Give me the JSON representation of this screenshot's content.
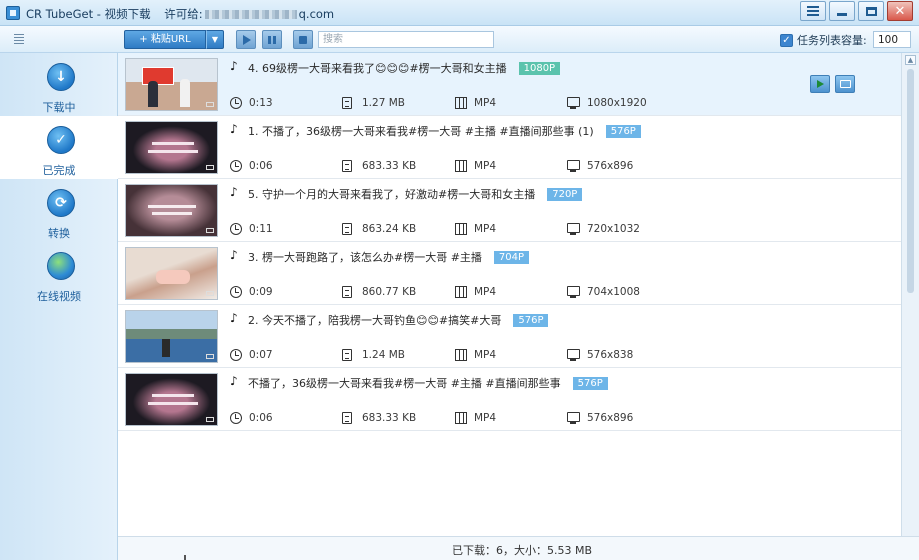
{
  "window": {
    "title_prefix": "CR TubeGet - 视频下载",
    "license_label": "许可给:",
    "license_suffix": "q.com"
  },
  "toolbar": {
    "paste_label": "+ 粘贴URL",
    "search_placeholder": "搜索",
    "capacity_label": "任务列表容量:",
    "capacity_value": "100",
    "capacity_checked": true
  },
  "sidebar": {
    "items": [
      {
        "label": "下载中",
        "icon": "download-icon"
      },
      {
        "label": "已完成",
        "icon": "check-icon"
      },
      {
        "label": "转换",
        "icon": "convert-icon"
      },
      {
        "label": "在线视频",
        "icon": "globe-icon"
      }
    ],
    "active_index": 1
  },
  "videos": [
    {
      "title": "4. 69级楞一大哥来看我了😊😊😊#楞一大哥和女主播",
      "resolution_badge": "1080P",
      "duration": "0:13",
      "size": "1.27 MB",
      "format": "MP4",
      "dimensions": "1080x1920"
    },
    {
      "title": "1. 不播了，36级楞一大哥来看我#楞一大哥 #主播 #直播间那些事 (1)",
      "resolution_badge": "576P",
      "duration": "0:06",
      "size": "683.33 KB",
      "format": "MP4",
      "dimensions": "576x896"
    },
    {
      "title": "5. 守护一个月的大哥来看我了，好激动#楞一大哥和女主播",
      "resolution_badge": "720P",
      "duration": "0:11",
      "size": "863.24 KB",
      "format": "MP4",
      "dimensions": "720x1032"
    },
    {
      "title": "3. 楞一大哥跑路了，该怎么办#楞一大哥 #主播",
      "resolution_badge": "704P",
      "duration": "0:09",
      "size": "860.77 KB",
      "format": "MP4",
      "dimensions": "704x1008"
    },
    {
      "title": "2. 今天不播了，陪我楞一大哥钓鱼😊😊#搞笑#大哥",
      "resolution_badge": "576P",
      "duration": "0:07",
      "size": "1.24 MB",
      "format": "MP4",
      "dimensions": "576x838"
    },
    {
      "title": "不播了，36级楞一大哥来看我#楞一大哥 #主播 #直播间那些事",
      "resolution_badge": "576P",
      "duration": "0:06",
      "size": "683.33 KB",
      "format": "MP4",
      "dimensions": "576x896"
    }
  ],
  "status": {
    "text": "已下载：6，大小：5.53 MB"
  },
  "colors": {
    "accent": "#2f7bc4",
    "badge_blue": "#6db5e8",
    "badge_green": "#5bc3ad",
    "selected_row": "#e7f3fd"
  }
}
